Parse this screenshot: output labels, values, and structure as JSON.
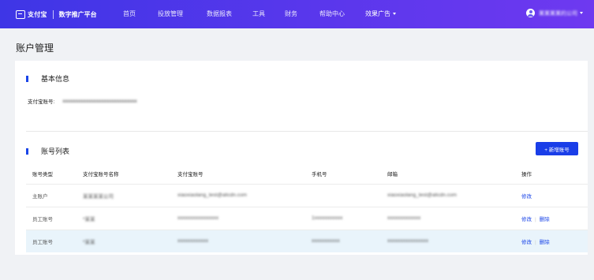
{
  "header": {
    "logo_text": "支付宝",
    "platform_name": "数字推广平台",
    "nav": [
      {
        "label": "首页"
      },
      {
        "label": "投放管理"
      },
      {
        "label": "数据报表"
      },
      {
        "label": "工具"
      },
      {
        "label": "财务"
      },
      {
        "label": "帮助中心"
      },
      {
        "label": "效果广告"
      }
    ],
    "user_name": "某某某某的公司"
  },
  "page_title": "账户管理",
  "basic_info": {
    "section_title": "基本信息",
    "account_label": "支付宝账号:",
    "account_value": "xxxxxxxxxxxxxxxxxxxxxxxxxxxxx"
  },
  "account_list": {
    "section_title": "账号列表",
    "add_button": "+ 新增账号",
    "columns": [
      "账号类型",
      "支付宝账号名称",
      "支付宝账号",
      "手机号",
      "邮箱",
      "操作"
    ],
    "rows": [
      {
        "type": "主账户",
        "name": "某某某某公司",
        "account": "xiaoxiaolang_test@alicdn.com",
        "phone": "",
        "email": "xiaoxiaolang_test@alicdn.com",
        "ops": [
          "修改"
        ]
      },
      {
        "type": "员工账号",
        "name": "*某某",
        "account": "xxxxxxxxxxxxxxxx",
        "phone": "1xxxxxxxxxxx",
        "email": "xxxxxxxxxxxxx",
        "ops": [
          "修改",
          "删除"
        ]
      },
      {
        "type": "员工账号",
        "name": "*某某",
        "account": "xxxxxxxxxxxx",
        "phone": "xxxxxxxxxxx",
        "email": "xxxxxxxxxxxxxxxx",
        "ops": [
          "修改",
          "删除"
        ]
      }
    ]
  },
  "colors": {
    "nav_start": "#3e36e6",
    "nav_end": "#6e39f0",
    "accent": "#1a45e8",
    "row_highlight": "#e9f4fb"
  },
  "icons": {
    "logo": "alipay-logo-icon",
    "avatar": "user-avatar-icon",
    "dropdown": "caret-down-icon"
  }
}
